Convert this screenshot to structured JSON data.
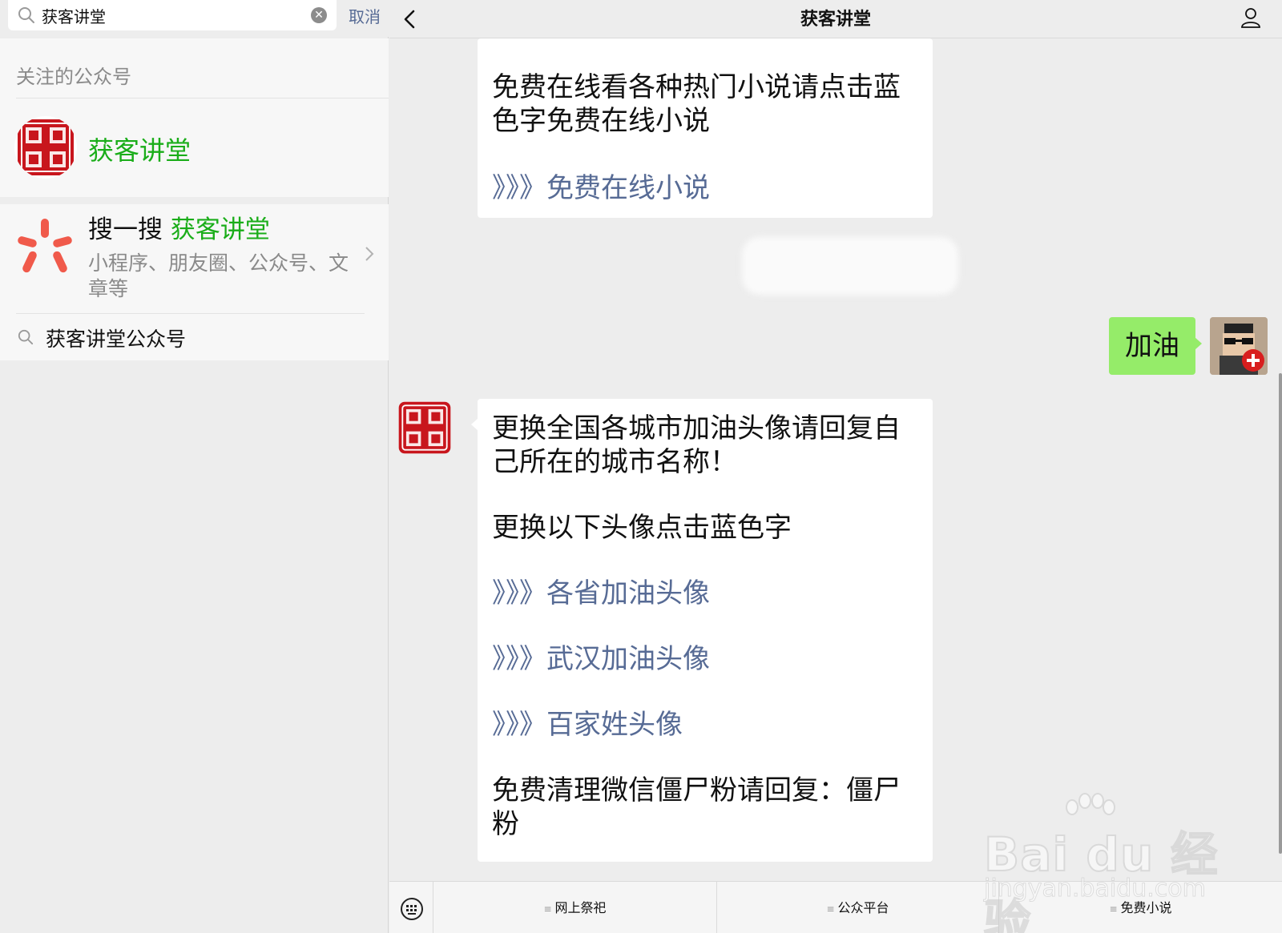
{
  "search": {
    "value": "获客讲堂",
    "cancel_label": "取消"
  },
  "followed": {
    "section_title": "关注的公众号",
    "account_name": "获客讲堂"
  },
  "souyisou": {
    "title_prefix": "搜一搜",
    "title_highlight": "获客讲堂",
    "description": "小程序、朋友圈、公众号、文章等",
    "suggestion": "获客讲堂公众号"
  },
  "chat": {
    "title": "获客讲堂",
    "messages": [
      {
        "paragraphs": [
          "免费在线看各种热门小说请点击蓝色字免费在线小说"
        ],
        "links": [
          "》》》免费在线小说"
        ]
      },
      {
        "sent_text": "加油"
      },
      {
        "intro": "更换全国各城市加油头像请回复自己所在的城市名称！",
        "subtitle": "更换以下头像点击蓝色字",
        "links": [
          "》》》各省加油头像",
          "》》》武汉加油头像",
          "》》》百家姓头像"
        ],
        "footer": "免费清理微信僵尸粉请回复：僵尸粉"
      }
    ]
  },
  "bottom_menu": {
    "items": [
      "网上祭祀",
      "公众平台",
      "免费小说"
    ]
  },
  "colors": {
    "accent_green": "#1aad19",
    "link_blue": "#576b95",
    "sent_bubble": "#95ec69",
    "seal_red": "#c8161d"
  },
  "icons": [
    "search-icon",
    "clear-icon",
    "back-icon",
    "profile-icon",
    "keyboard-icon",
    "souyisou-logo-icon",
    "chevron-right-icon"
  ],
  "watermark": {
    "main": "Bai du 经验",
    "sub": "jingyan.baidu.com"
  }
}
